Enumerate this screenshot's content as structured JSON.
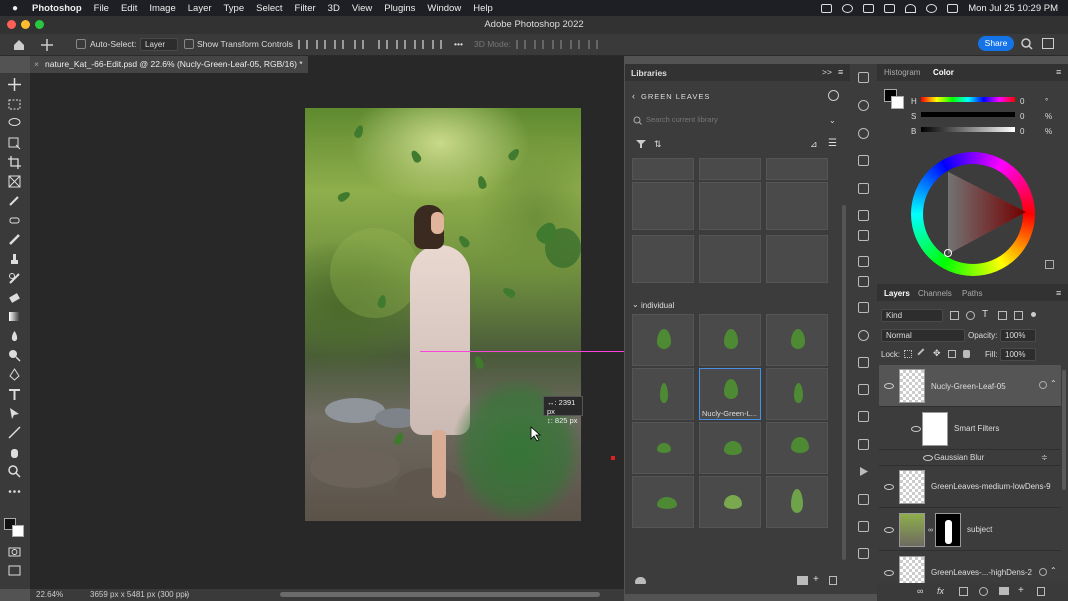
{
  "menubar": {
    "app": "Photoshop",
    "items": [
      "File",
      "Edit",
      "Image",
      "Layer",
      "Type",
      "Select",
      "Filter",
      "3D",
      "View",
      "Plugins",
      "Window",
      "Help"
    ],
    "datetime": "Mon Jul 25  10:29 PM"
  },
  "window": {
    "title": "Adobe Photoshop 2022"
  },
  "options": {
    "auto_select_label": "Auto-Select:",
    "auto_select_value": "Layer",
    "transform_label": "Show Transform Controls",
    "mode3d_label": "3D Mode:",
    "more": "•••",
    "share_label": "Share"
  },
  "document": {
    "tab_title": "nature_Kat_-66-Edit.psd @ 22.6% (Nucly-Green-Leaf-05, RGB/16) *",
    "tab_close": "×",
    "measure_w": "↔: 2391 px",
    "measure_h": "↕: 825 px"
  },
  "status": {
    "zoom": "22.64%",
    "info": "3659 px x 5481 px (300 ppi)"
  },
  "libraries": {
    "title": "Libraries",
    "collapse": ">>",
    "library_name": "GREEN LEAVES",
    "search_placeholder": "Search current library",
    "section": "individual",
    "selected_item_label": "Nucly-Green-L..."
  },
  "color": {
    "tab_histogram": "Histogram",
    "tab_color": "Color",
    "h_label": "H",
    "h_value": "0",
    "h_unit": "°",
    "s_label": "S",
    "s_value": "0",
    "s_unit": "%",
    "b_label": "B",
    "b_value": "0",
    "b_unit": "%"
  },
  "layers": {
    "tab_layers": "Layers",
    "tab_channels": "Channels",
    "tab_paths": "Paths",
    "kind_filter": "Kind",
    "blend_mode": "Normal",
    "opacity_label": "Opacity:",
    "opacity_value": "100%",
    "lock_label": "Lock:",
    "fill_label": "Fill:",
    "fill_value": "100%",
    "items": [
      {
        "name": "Nucly-Green-Leaf-05"
      },
      {
        "name": "Smart Filters"
      },
      {
        "name": "Gaussian Blur"
      },
      {
        "name": "GreenLeaves-medium-lowDens-9"
      },
      {
        "name": "subject"
      },
      {
        "name": "GreenLeaves-...-highDens-2"
      }
    ]
  },
  "accent_color": "#1473e6"
}
